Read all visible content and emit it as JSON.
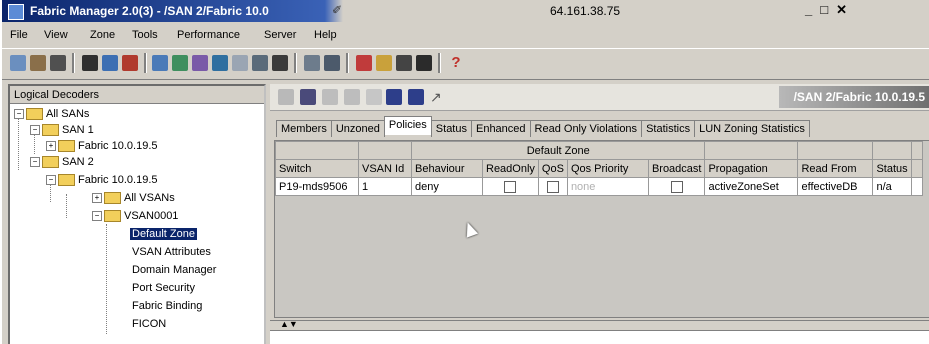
{
  "window": {
    "title": "Fabric Manager 2.0(3) - /SAN 2/Fabric 10.0",
    "address": "64.161.38.75",
    "controls": "_ Ɇ ×"
  },
  "menu": [
    {
      "label": "File"
    },
    {
      "label": "View"
    },
    {
      "label": "Zone"
    },
    {
      "label": "Tools"
    },
    {
      "label": "Performance"
    },
    {
      "label": "Server"
    },
    {
      "label": "Help"
    }
  ],
  "left_panel": {
    "header": "Logical Decoders",
    "tree": [
      {
        "label": "All SANs"
      },
      {
        "label": "SAN 1"
      },
      {
        "label": "Fabric 10.0.19.5"
      },
      {
        "label": "SAN 2"
      },
      {
        "label": "Fabric 10.0.19.5"
      },
      {
        "label": "All VSANs"
      },
      {
        "label": "VSAN0001"
      },
      {
        "label": "Default Zone"
      },
      {
        "label": "VSAN Attributes"
      },
      {
        "label": "Domain Manager"
      },
      {
        "label": "Port Security"
      },
      {
        "label": "Fabric Binding"
      },
      {
        "label": "FICON"
      }
    ]
  },
  "right_panel": {
    "title": "/SAN 2/Fabric 10.0.19.5",
    "tabs": [
      {
        "label": "Members"
      },
      {
        "label": "Unzoned"
      },
      {
        "label": "Policies"
      },
      {
        "label": "Status"
      },
      {
        "label": "Enhanced"
      },
      {
        "label": "Read Only Violations"
      },
      {
        "label": "Statistics"
      },
      {
        "label": "LUN Zoning Statistics"
      }
    ],
    "table": {
      "group_header": "Default Zone",
      "headers": [
        "Switch",
        "VSAN Id",
        "Behaviour",
        "ReadOnly",
        "QoS",
        "Qos Priority",
        "Broadcast",
        "Propagation",
        "Read From",
        "Status"
      ],
      "rows": [
        {
          "switch": "P19-mds9506",
          "vsan_id": "1",
          "behaviour": "deny",
          "qos_priority": "none",
          "propagation": "activeZoneSet",
          "read_from": "effectiveDB",
          "status": "n/a"
        }
      ]
    }
  },
  "colors": {
    "titlebar_active": "#0a246a",
    "selection": "#0a246a",
    "folder": "#f2cf5b",
    "window_face": "#d4d0c8"
  }
}
